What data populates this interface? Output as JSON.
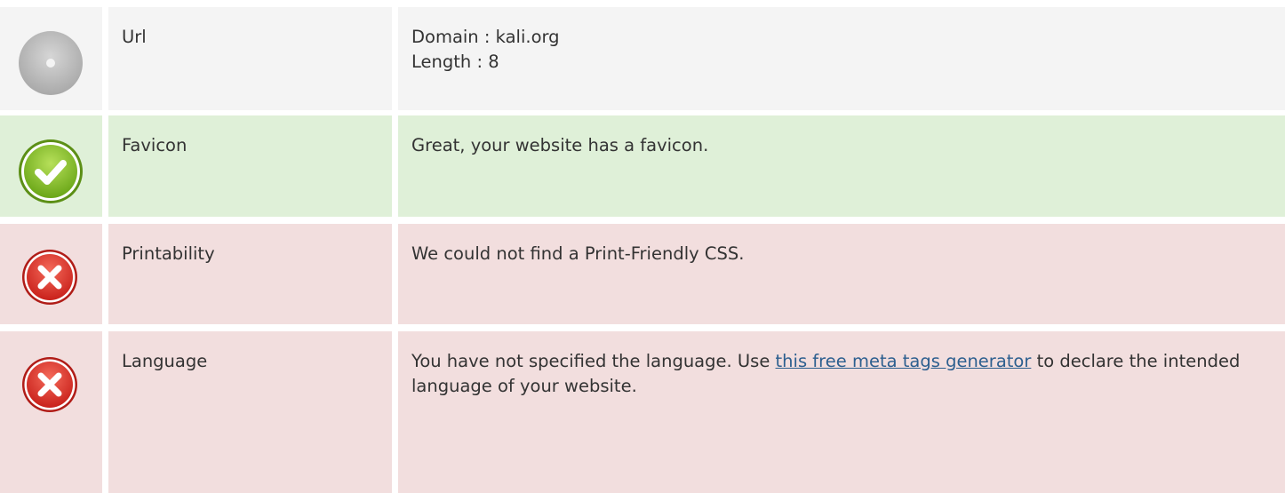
{
  "rows": [
    {
      "status": "neutral",
      "label": "Url",
      "lines": [
        "Domain : kali.org",
        "Length : 8"
      ]
    },
    {
      "status": "pass",
      "label": "Favicon",
      "text": "Great, your website has a favicon."
    },
    {
      "status": "fail",
      "label": "Printability",
      "text": "We could not find a Print-Friendly CSS."
    },
    {
      "status": "fail",
      "label": "Language",
      "text_before": "You have not specified the language. Use ",
      "link_text": "this free meta tags generator",
      "text_after": " to declare the intended language of your website."
    }
  ],
  "colors": {
    "neutral_bg": "#f4f4f4",
    "pass_bg": "#dff0d8",
    "fail_bg": "#f2dede",
    "link": "#2d5f8f"
  },
  "icons": {
    "neutral": "neutral-circle-icon",
    "pass": "check-circle-icon",
    "fail": "error-x-circle-icon"
  }
}
